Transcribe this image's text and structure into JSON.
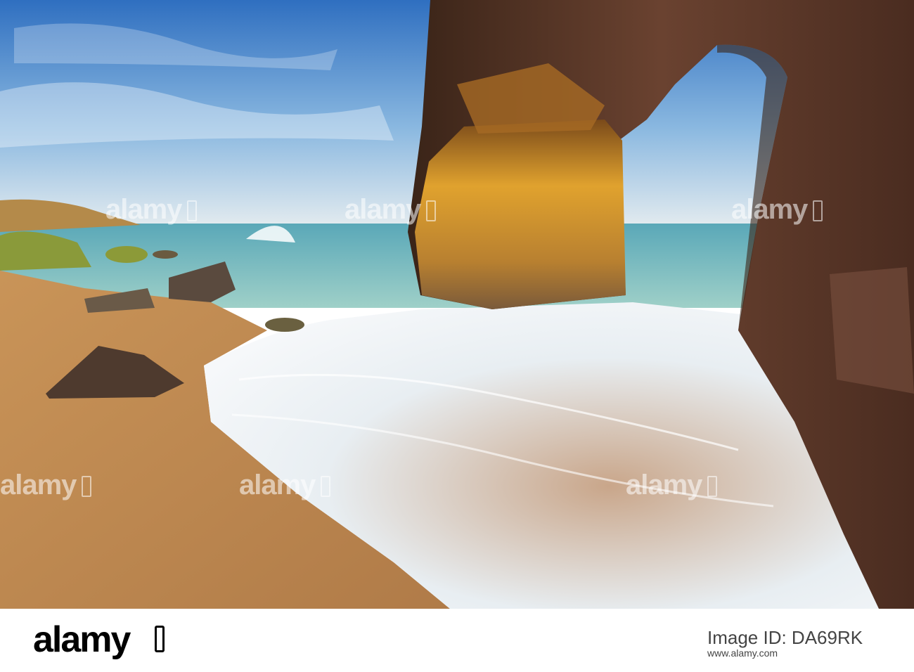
{
  "watermark": {
    "text": "alamy"
  },
  "footer": {
    "logo_text": "alamy",
    "image_id": "Image ID: DA69RK",
    "url": "www.alamy.com"
  },
  "colors": {
    "sky_top": "#3a7ec9",
    "sea": "#6fb7b3",
    "sand": "#cfa06a",
    "rock": "#5a3a2a",
    "rock_lit": "#d99a2a"
  }
}
